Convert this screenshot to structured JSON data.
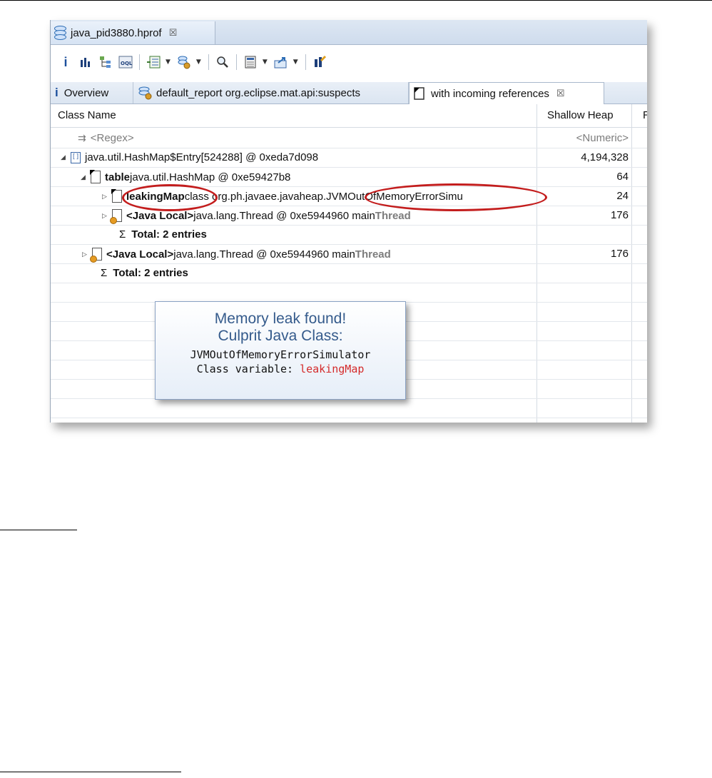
{
  "editor": {
    "tab_title": "java_pid3880.hprof"
  },
  "subtabs": [
    {
      "label": "Overview",
      "icon": "info-icon"
    },
    {
      "label": "default_report  org.eclipse.mat.api:suspects",
      "icon": "report-db-icon"
    },
    {
      "label": "with incoming references",
      "icon": "query-result-icon"
    }
  ],
  "columns": {
    "class_name": "Class Name",
    "shallow_heap": "Shallow Heap",
    "retained": "R"
  },
  "rows": [
    {
      "name": "<Regex>",
      "value": "<Numeric>"
    },
    {
      "name": "java.util.HashMap$Entry[524288] @ 0xeda7d098",
      "value": "4,194,328"
    },
    {
      "bold": "table",
      "name": " java.util.HashMap @ 0xe59427b8",
      "value": "64"
    },
    {
      "bold": "leakingMap",
      "name": " class org.ph.javaee.javaheap.JVMOutOfMemoryErrorSimu",
      "value": "24"
    },
    {
      "bold": "<Java Local>",
      "name": " java.lang.Thread @ 0xe5944960  main ",
      "tag": "Thread",
      "value": "176"
    },
    {
      "bold": "Total: 2 entries",
      "symbol": "Σ"
    },
    {
      "bold": "<Java Local>",
      "name": " java.lang.Thread @ 0xe5944960  main ",
      "tag": "Thread",
      "value": "176"
    },
    {
      "bold": "Total: 2 entries",
      "symbol": "Σ"
    }
  ],
  "callout": {
    "line1": "Memory leak found!",
    "line2": "Culprit Java Class:",
    "line3": "JVMOutOfMemoryErrorSimulator",
    "line4_prefix": "Class variable: ",
    "line4_value": "leakingMap"
  },
  "colors": {
    "highlight": "#c31d1d",
    "callout_title": "#355b8c"
  }
}
